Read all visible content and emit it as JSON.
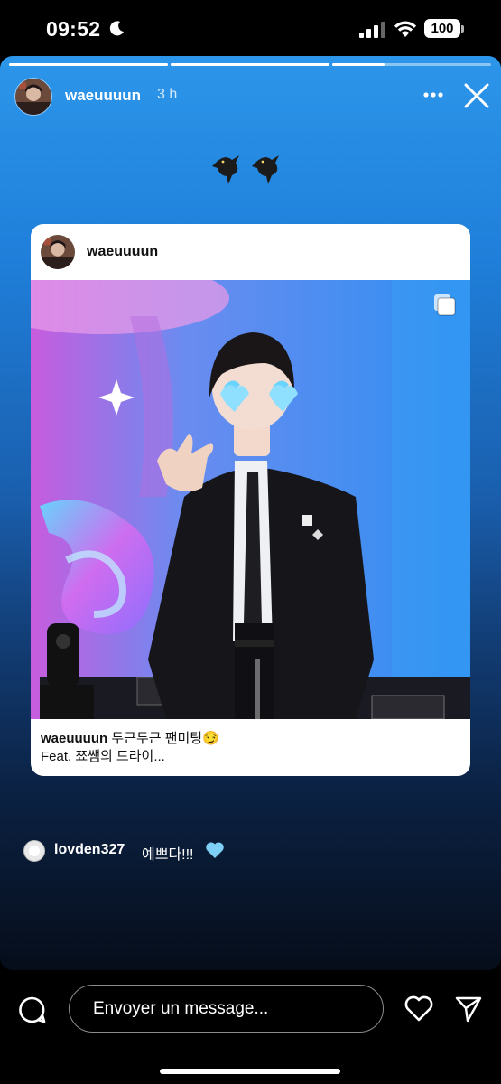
{
  "status_bar": {
    "time": "09:52",
    "battery": "100"
  },
  "story": {
    "progress": [
      1.0,
      1.0,
      0.33
    ],
    "username": "waeuuuun",
    "time_ago": "3 h"
  },
  "post": {
    "username": "waeuuuun",
    "caption_user": "waeuuuun",
    "caption_line1": "두근두근 팬미팅😏",
    "caption_line2": "Feat. 쬬쌤의 드라이..."
  },
  "reply": {
    "username": "lovden327",
    "text": "예쁘다!!!"
  },
  "footer": {
    "message_placeholder": "Envoyer un message..."
  },
  "icons": [
    "moon-icon",
    "signal-icon",
    "wifi-icon",
    "battery-icon",
    "more-icon",
    "close-icon",
    "bird-sticker-icon",
    "carousel-icon",
    "blue-heart-icon",
    "comment-icon",
    "heart-icon",
    "send-icon"
  ]
}
